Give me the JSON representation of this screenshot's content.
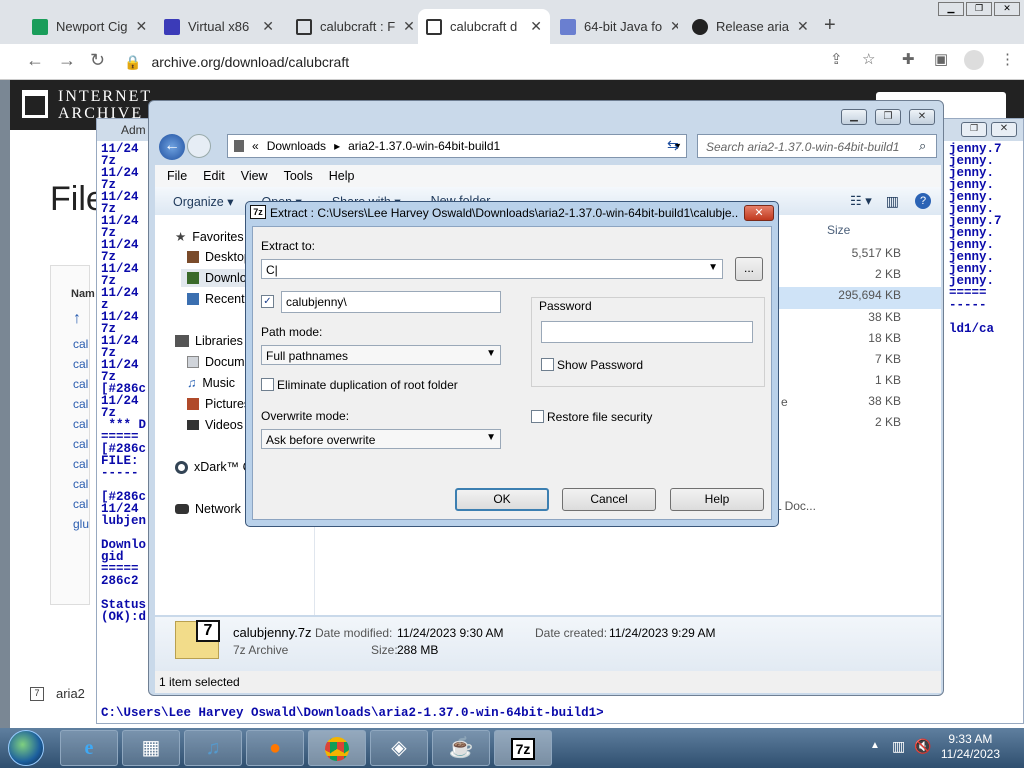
{
  "browser": {
    "tabs": [
      {
        "label": "Newport Cig",
        "color": "#1a9d5a"
      },
      {
        "label": "Virtual x86",
        "color": "#3b3bb8"
      },
      {
        "label": "calubcraft : F",
        "color": "#333333"
      },
      {
        "label": "calubcraft d",
        "color": "#333333"
      },
      {
        "label": "64-bit Java fo",
        "color": "#6a7fd0"
      },
      {
        "label": "Release aria",
        "color": "#222222"
      }
    ],
    "new_tab": "+",
    "url": "archive.org/download/calubcraft"
  },
  "ia_page": {
    "logo_line1": "INTERNET",
    "logo_line2": "ARCHIVE",
    "heading": "File",
    "col_name": "Nam",
    "rows": [
      "cal",
      "cal",
      "cal",
      "cal",
      "cal",
      "cal",
      "cal",
      "cal",
      "cal",
      "glu"
    ],
    "footer_item": "aria2"
  },
  "cmd": {
    "title": "Adm",
    "left_lines": [
      "11/24",
      "7z",
      "11/24",
      "7z",
      "11/24",
      "7z",
      "11/24",
      "7z",
      "11/24",
      "7z",
      "11/24",
      "7z",
      "11/24",
      "z",
      "11/24",
      "7z",
      "11/24",
      "7z",
      "11/24",
      "7z",
      "[#286c",
      "11/24",
      "7z",
      " *** D",
      "=====",
      "[#286c",
      "FILE:",
      "-----",
      "",
      "[#286c",
      "11/24",
      "lubjen",
      "",
      "Downlo",
      "gid",
      "=====",
      "286c2",
      "",
      "Status",
      "(OK):d"
    ],
    "right_lines": [
      "jenny.7",
      "jenny.",
      "jenny.",
      "jenny.",
      "jenny.",
      "jenny.",
      "jenny.7",
      "jenny.",
      "jenny.",
      "jenny.",
      "jenny.",
      "jenny.",
      "=====",
      "-----",
      "",
      "ld1/ca"
    ],
    "prompt": "C:\\Users\\Lee Harvey Oswald\\Downloads\\aria2-1.37.0-win-64bit-build1>"
  },
  "explorer": {
    "breadcrumb": [
      "«",
      "Downloads",
      "aria2-1.37.0-win-64bit-build1"
    ],
    "search_placeholder": "Search aria2-1.37.0-win-64bit-build1",
    "menu": [
      "File",
      "Edit",
      "View",
      "Tools",
      "Help"
    ],
    "toolbar": {
      "organize": "Organize",
      "open": "Open",
      "share": "Share with",
      "new_folder": "New folder"
    },
    "nav": {
      "favorites": "Favorites",
      "desktop": "Desktop",
      "downloads": "Downlo",
      "recent": "Recent",
      "libraries": "Libraries",
      "documents": "Docum",
      "music": "Music",
      "pictures": "Pictures",
      "videos": "Videos",
      "xdark": "xDark™ C",
      "network": "Network"
    },
    "col_size": "Size",
    "sizes": [
      "5,517 KB",
      "2 KB",
      "295,694 KB",
      "38 KB",
      "18 KB",
      "7 KB",
      "1 KB",
      "38 KB",
      "2 KB"
    ],
    "type_fragments": [
      "e",
      "L Doc..."
    ],
    "details": {
      "filename": "calubjenny.7z",
      "type": "7z Archive",
      "modified_label": "Date modified:",
      "modified": "11/24/2023 9:30 AM",
      "created_label": "Date created:",
      "created": "11/24/2023 9:29 AM",
      "size_label": "Size:",
      "size": "288 MB",
      "icon_text": "7"
    },
    "status": "1 item selected"
  },
  "dialog": {
    "title": "Extract : C:\\Users\\Lee Harvey Oswald\\Downloads\\aria2-1.37.0-win-64bit-build1\\calubje...",
    "title_icon": "7z",
    "extract_to_label": "Extract to:",
    "extract_to_value": "C|",
    "browse": "...",
    "subfolder_checked": "✓",
    "subfolder": "calubjenny\\",
    "path_mode_label": "Path mode:",
    "path_mode": "Full pathnames",
    "eliminate": "Eliminate duplication of root folder",
    "overwrite_label": "Overwrite mode:",
    "overwrite": "Ask before overwrite",
    "password_label": "Password",
    "show_password": "Show Password",
    "restore_security": "Restore file security",
    "ok": "OK",
    "cancel": "Cancel",
    "help": "Help"
  },
  "taskbar": {
    "time": "9:33 AM",
    "date": "11/24/2023",
    "sevenzip": "7z"
  }
}
